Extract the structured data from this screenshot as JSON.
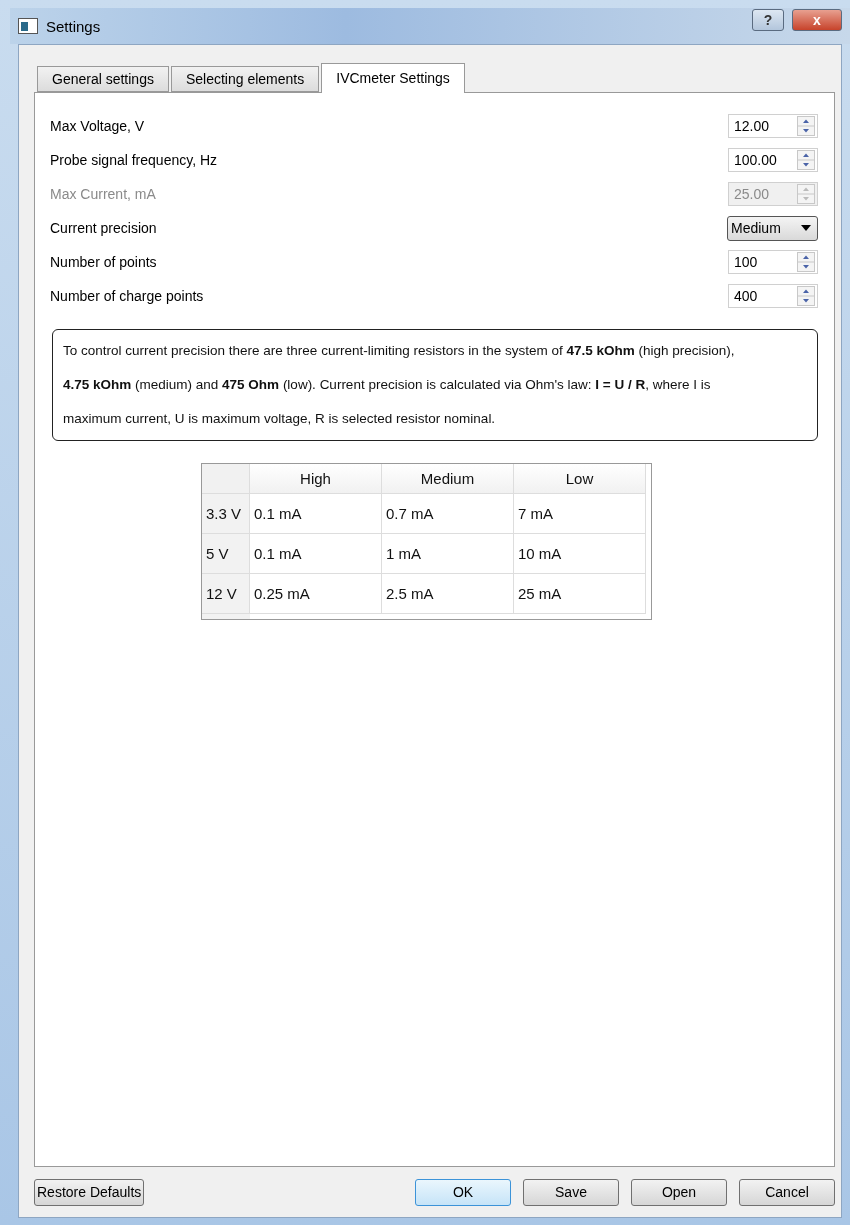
{
  "window": {
    "title": "Settings",
    "buttons": [
      {
        "label": "?",
        "kind": "help"
      },
      {
        "label": "x",
        "kind": "close"
      }
    ]
  },
  "tabs": [
    {
      "label": "General settings",
      "selected": false
    },
    {
      "label": "Selecting elements",
      "selected": false
    },
    {
      "label": "IVCmeter Settings",
      "selected": true
    }
  ],
  "fields": [
    {
      "label": "Max Voltage, V",
      "kind": "spin",
      "value": "12.00",
      "disabled": false
    },
    {
      "label": "Probe signal frequency, Hz",
      "kind": "spin",
      "value": "100.00",
      "disabled": false
    },
    {
      "label": "Max Current, mA",
      "kind": "spin",
      "value": "25.00",
      "disabled": true
    },
    {
      "label": "Current precision",
      "kind": "combo",
      "value": "Medium",
      "disabled": false
    },
    {
      "label": "Number of points",
      "kind": "spin",
      "value": "100",
      "disabled": false
    },
    {
      "label": "Number of charge points",
      "kind": "spin",
      "value": "400",
      "disabled": false
    }
  ],
  "info": "To control current precision there are three current-limiting resistors in the system of **47.5 kOhm** (high precision), **4.75 kOhm** (medium) and **475 Ohm** (low). Current precision is calculated via Ohm's law: **I = U / R**, where I is maximum current, U is maximum voltage, R is selected resistor nominal.",
  "table": {
    "columns": [
      "High",
      "Medium",
      "Low"
    ],
    "rows": [
      {
        "header": "3.3 V",
        "cells": [
          "0.1 mA",
          "0.7 mA",
          "7 mA"
        ]
      },
      {
        "header": "5 V",
        "cells": [
          "0.1 mA",
          "1 mA",
          "10 mA"
        ]
      },
      {
        "header": "12 V",
        "cells": [
          "0.25 mA",
          "2.5 mA",
          "25 mA"
        ]
      }
    ]
  },
  "buttons": [
    {
      "label": "Restore Defaults",
      "default": false
    },
    {
      "label": "OK",
      "default": true
    },
    {
      "label": "Save",
      "default": false
    },
    {
      "label": "Open",
      "default": false
    },
    {
      "label": "Cancel",
      "default": false
    }
  ]
}
